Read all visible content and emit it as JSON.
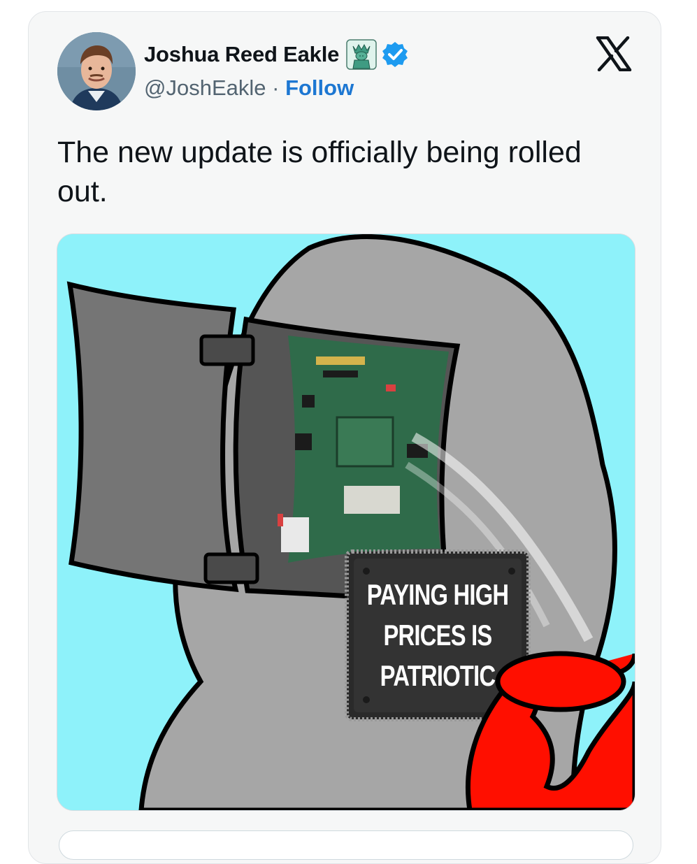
{
  "tweet": {
    "author": {
      "display_name": "Joshua Reed Eakle",
      "handle": "@JoshEakle",
      "emoji_icon": "statue-of-liberty-icon",
      "verified_icon": "verified-badge-icon",
      "avatar": "avatar"
    },
    "separator": " · ",
    "follow_label": "Follow",
    "platform_icon": "x-logo-icon",
    "text": "The new update is officially being rolled out.",
    "media": {
      "chip_lines": [
        "PAYING HIGH",
        "PRICES IS",
        "PATRIOTIC"
      ]
    }
  },
  "colors": {
    "card_background": "#f6f7f7",
    "text_primary": "#0f1419",
    "text_secondary": "#536471",
    "link_blue": "#1d77d2",
    "verified_blue": "#1d9bf0",
    "image_sky": "#8ef2fa",
    "head_gray": "#a6a6a6",
    "hand_red": "#ff0f00"
  }
}
